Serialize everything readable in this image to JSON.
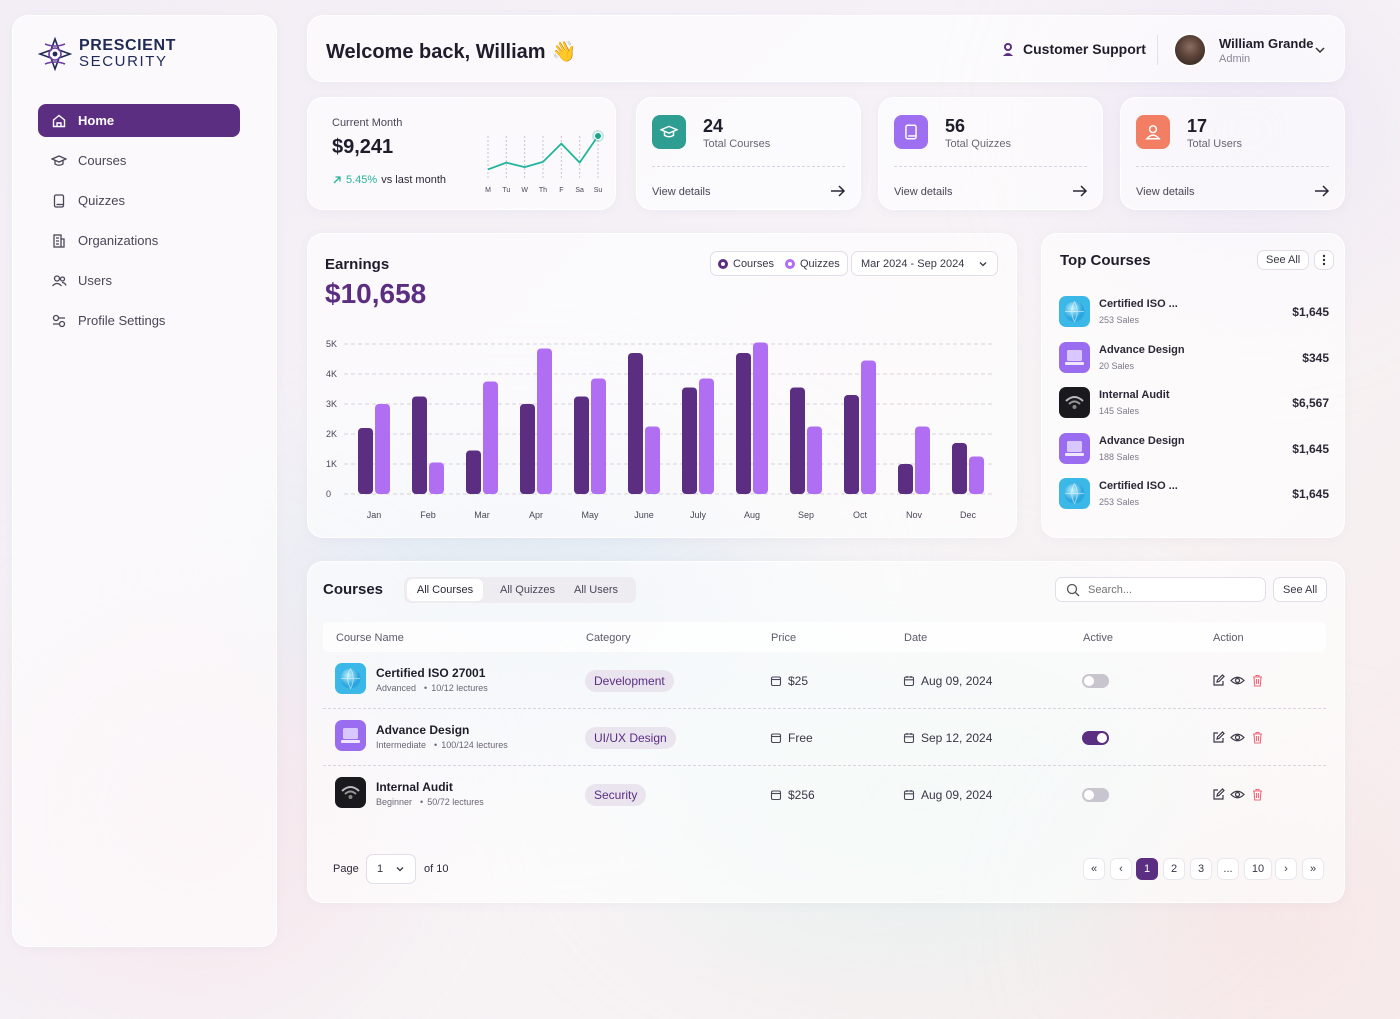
{
  "brand": {
    "name_top": "PRESCIENT",
    "name_bottom": "SECURITY"
  },
  "sidebar": {
    "items": [
      {
        "label": "Home",
        "icon": "home-icon",
        "active": true
      },
      {
        "label": "Courses",
        "icon": "graduation-cap-icon"
      },
      {
        "label": "Quizzes",
        "icon": "book-icon"
      },
      {
        "label": "Organizations",
        "icon": "building-icon"
      },
      {
        "label": "Users",
        "icon": "users-icon"
      },
      {
        "label": "Profile Settings",
        "icon": "settings-icon"
      }
    ]
  },
  "header": {
    "welcome": "Welcome back, William",
    "wave": "👋",
    "support": "Customer Support",
    "user_name": "William Grande",
    "user_role": "Admin"
  },
  "summary": {
    "label": "Current Month",
    "value": "$9,241",
    "change": "5.45%",
    "change_suffix": "vs last month",
    "spark_days": [
      "M",
      "Tu",
      "W",
      "Th",
      "F",
      "Sa",
      "Su"
    ],
    "spark_values": [
      0.12,
      0.3,
      0.18,
      0.32,
      0.8,
      0.3,
      1.0
    ]
  },
  "stats": [
    {
      "value": "24",
      "label": "Total Courses",
      "link": "View details",
      "color": "#2f9e92",
      "icon": "graduation-cap-icon"
    },
    {
      "value": "56",
      "label": "Total Quizzes",
      "link": "View details",
      "color": "#9e6ff0",
      "icon": "book-icon"
    },
    {
      "value": "17",
      "label": "Total Users",
      "link": "View details",
      "color": "#f27e63",
      "icon": "user-icon"
    }
  ],
  "earnings": {
    "title": "Earnings",
    "total": "$10,658",
    "legend_courses": "Courses",
    "legend_quizzes": "Quizzes",
    "range": "Mar 2024 - Sep 2024"
  },
  "chart_data": {
    "type": "bar",
    "categories": [
      "Jan",
      "Feb",
      "Mar",
      "Apr",
      "May",
      "June",
      "July",
      "Aug",
      "Sep",
      "Oct",
      "Nov",
      "Dec"
    ],
    "series": [
      {
        "name": "Courses",
        "color": "#5b2e82",
        "values": [
          2200,
          3250,
          1450,
          3000,
          3250,
          4700,
          3550,
          4700,
          3550,
          3300,
          1000,
          1700
        ]
      },
      {
        "name": "Quizzes",
        "color": "#b06ef2",
        "values": [
          3000,
          1050,
          3750,
          4850,
          3850,
          2250,
          3850,
          5050,
          2250,
          4450,
          2250,
          1250
        ]
      }
    ],
    "yticks": [
      "0",
      "1K",
      "2K",
      "3K",
      "4K",
      "5K"
    ],
    "ylim": [
      0,
      5000
    ],
    "grid": true
  },
  "top_courses": {
    "title": "Top Courses",
    "see_all": "See All",
    "items": [
      {
        "name": "Certified ISO ...",
        "sales": "253 Sales",
        "price": "$1,645",
        "icon": "globe-icon",
        "color": "#3bb8e8"
      },
      {
        "name": "Advance Design",
        "sales": "20 Sales",
        "price": "$345",
        "icon": "laptop-icon",
        "color": "#9a6cf0"
      },
      {
        "name": "Internal Audit",
        "sales": "145 Sales",
        "price": "$6,567",
        "icon": "wifi-icon",
        "color": "#1a1a1e"
      },
      {
        "name": "Advance Design",
        "sales": "188 Sales",
        "price": "$1,645",
        "icon": "laptop-icon",
        "color": "#9a6cf0"
      },
      {
        "name": "Certified ISO ...",
        "sales": "253 Sales",
        "price": "$1,645",
        "icon": "globe-icon",
        "color": "#3bb8e8"
      }
    ]
  },
  "courses": {
    "title": "Courses",
    "tabs": [
      "All Courses",
      "All Quizzes",
      "All Users"
    ],
    "search_placeholder": "Search...",
    "see_all": "See All",
    "columns": [
      "Course Name",
      "Category",
      "Price",
      "Date",
      "Active",
      "Action"
    ],
    "rows": [
      {
        "name": "Certified ISO 27001",
        "level": "Advanced",
        "lectures": "10/12 lectures",
        "category": "Development",
        "price": "$25",
        "date": "Aug 09, 2024",
        "active": false,
        "icon": "globe-icon",
        "color": "#3bb8e8"
      },
      {
        "name": "Advance Design",
        "level": "Intermediate",
        "lectures": "100/124 lectures",
        "category": "UI/UX Design",
        "price": "Free",
        "date": "Sep 12, 2024",
        "active": true,
        "icon": "laptop-icon",
        "color": "#9a6cf0"
      },
      {
        "name": "Internal Audit",
        "level": "Beginner",
        "lectures": "50/72 lectures",
        "category": "Security",
        "price": "$256",
        "date": "Aug 09, 2024",
        "active": false,
        "icon": "wifi-icon",
        "color": "#1a1a1e"
      }
    ],
    "pagination": {
      "page_label": "Page",
      "current": "1",
      "of": "of 10",
      "pages": [
        "1",
        "2",
        "3",
        "...",
        "10"
      ],
      "first": "«",
      "prev": "‹",
      "next": "›",
      "last": "»"
    }
  }
}
